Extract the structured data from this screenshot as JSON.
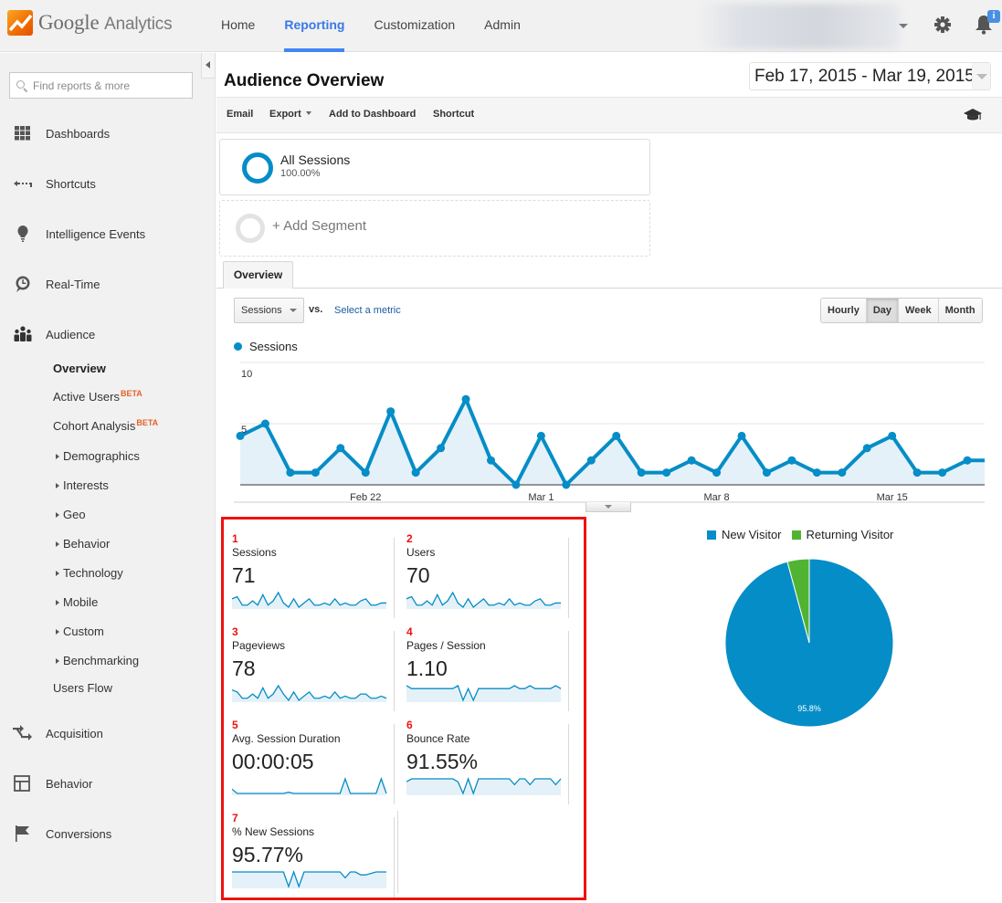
{
  "app": {
    "logo_google": "Google",
    "logo_product": "Analytics",
    "nav": [
      {
        "label": "Home",
        "active": false
      },
      {
        "label": "Reporting",
        "active": true
      },
      {
        "label": "Customization",
        "active": false
      },
      {
        "label": "Admin",
        "active": false
      }
    ],
    "notification_badge": "i"
  },
  "sidebar": {
    "search_placeholder": "Find reports & more",
    "sections": [
      {
        "label": "Dashboards",
        "icon": "grid-icon"
      },
      {
        "label": "Shortcuts",
        "icon": "shortcut-arrow-icon"
      },
      {
        "label": "Intelligence Events",
        "icon": "lightbulb-icon"
      },
      {
        "label": "Real-Time",
        "icon": "clock-bubble-icon"
      },
      {
        "label": "Audience",
        "icon": "people-icon"
      }
    ],
    "audience_items": [
      {
        "label": "Overview",
        "active": true,
        "expandable": false,
        "beta": ""
      },
      {
        "label": "Active Users",
        "active": false,
        "expandable": false,
        "beta": "BETA"
      },
      {
        "label": "Cohort Analysis",
        "active": false,
        "expandable": false,
        "beta": "BETA"
      },
      {
        "label": "Demographics",
        "active": false,
        "expandable": true,
        "beta": ""
      },
      {
        "label": "Interests",
        "active": false,
        "expandable": true,
        "beta": ""
      },
      {
        "label": "Geo",
        "active": false,
        "expandable": true,
        "beta": ""
      },
      {
        "label": "Behavior",
        "active": false,
        "expandable": true,
        "beta": ""
      },
      {
        "label": "Technology",
        "active": false,
        "expandable": true,
        "beta": ""
      },
      {
        "label": "Mobile",
        "active": false,
        "expandable": true,
        "beta": ""
      },
      {
        "label": "Custom",
        "active": false,
        "expandable": true,
        "beta": ""
      },
      {
        "label": "Benchmarking",
        "active": false,
        "expandable": true,
        "beta": ""
      },
      {
        "label": "Users Flow",
        "active": false,
        "expandable": false,
        "beta": ""
      }
    ],
    "bottom_sections": [
      {
        "label": "Acquisition",
        "icon": "acquisition-arrows-icon"
      },
      {
        "label": "Behavior",
        "icon": "layout-icon"
      },
      {
        "label": "Conversions",
        "icon": "flag-icon"
      }
    ]
  },
  "report": {
    "title": "Audience Overview",
    "date_range": "Feb 17, 2015 - Mar 19, 2015",
    "toolbar": {
      "email": "Email",
      "export": "Export",
      "add_to_dashboard": "Add to Dashboard",
      "shortcut": "Shortcut"
    },
    "segments": {
      "primary_name": "All Sessions",
      "primary_pct": "100.00%",
      "add_label": "+ Add Segment"
    },
    "tab": "Overview",
    "metric_selector": "Sessions",
    "vs_label": "vs.",
    "select_metric": "Select a metric",
    "granularity": [
      {
        "label": "Hourly",
        "active": false
      },
      {
        "label": "Day",
        "active": true
      },
      {
        "label": "Week",
        "active": false
      },
      {
        "label": "Month",
        "active": false
      }
    ]
  },
  "chart_data": [
    {
      "type": "area",
      "title": "",
      "legend": [
        "Sessions"
      ],
      "series_color": "#058dc7",
      "fill_color": "#e5f1f8",
      "x": [
        "Feb 17",
        "Feb 18",
        "Feb 19",
        "Feb 20",
        "Feb 21",
        "Feb 22",
        "Feb 23",
        "Feb 24",
        "Feb 25",
        "Feb 26",
        "Feb 27",
        "Feb 28",
        "Mar 1",
        "Mar 2",
        "Mar 3",
        "Mar 4",
        "Mar 5",
        "Mar 6",
        "Mar 7",
        "Mar 8",
        "Mar 9",
        "Mar 10",
        "Mar 11",
        "Mar 12",
        "Mar 13",
        "Mar 14",
        "Mar 15",
        "Mar 16",
        "Mar 17",
        "Mar 18",
        "Mar 19"
      ],
      "series": [
        {
          "name": "Sessions",
          "values": [
            4,
            5,
            1,
            1,
            3,
            1,
            6,
            1,
            3,
            7,
            2,
            0,
            4,
            0,
            2,
            4,
            1,
            1,
            2,
            1,
            4,
            1,
            2,
            1,
            1,
            3,
            4,
            1,
            1,
            2,
            2
          ]
        }
      ],
      "x_tick_labels": [
        "Feb 22",
        "Mar 1",
        "Mar 8",
        "Mar 15"
      ],
      "y_tick_labels": [
        "5",
        "10"
      ],
      "ylim": [
        0,
        10
      ],
      "grid": true
    },
    {
      "type": "pie",
      "title": "",
      "legend_position": "top",
      "slices": [
        {
          "label": "New Visitor",
          "value": 95.8,
          "color": "#058dc7"
        },
        {
          "label": "Returning Visitor",
          "value": 4.2,
          "color": "#50b432"
        }
      ],
      "data_labels": [
        "95.8%"
      ]
    }
  ],
  "scorecards": [
    {
      "index": "1",
      "name": "Sessions",
      "value": "71",
      "spark": [
        4,
        5,
        1,
        1,
        3,
        1,
        6,
        1,
        3,
        7,
        2,
        0,
        4,
        0,
        2,
        4,
        1,
        1,
        2,
        1,
        4,
        1,
        2,
        1,
        1,
        3,
        4,
        1,
        1,
        2,
        2
      ],
      "baseline": true
    },
    {
      "index": "2",
      "name": "Users",
      "value": "70",
      "spark": [
        4,
        5,
        1,
        1,
        3,
        1,
        6,
        1,
        3,
        7,
        2,
        0,
        4,
        0,
        2,
        4,
        1,
        1,
        2,
        1,
        4,
        1,
        2,
        1,
        1,
        3,
        4,
        1,
        1,
        2,
        2
      ],
      "baseline": true
    },
    {
      "index": "3",
      "name": "Pageviews",
      "value": "78",
      "spark": [
        5,
        4,
        1,
        1,
        3,
        1,
        6,
        1,
        3,
        7,
        3,
        0,
        4,
        0,
        2,
        4,
        1,
        1,
        2,
        1,
        4,
        1,
        2,
        1,
        1,
        3,
        3,
        1,
        1,
        2,
        1
      ],
      "baseline": true
    },
    {
      "index": "4",
      "name": "Pages / Session",
      "value": "1.10",
      "spark": [
        1,
        0.8,
        0.8,
        0.8,
        0.8,
        0.8,
        0.8,
        0.8,
        0.8,
        0.8,
        1,
        0,
        0.8,
        0,
        0.8,
        0.8,
        0.8,
        0.8,
        0.8,
        0.8,
        0.8,
        1,
        0.8,
        0.8,
        1,
        0.8,
        0.8,
        0.8,
        0.8,
        1,
        0.8
      ],
      "baseline": false
    },
    {
      "index": "5",
      "name": "Avg. Session Duration",
      "value": "00:00:05",
      "spark": [
        0.3,
        0,
        0,
        0,
        0,
        0,
        0,
        0,
        0,
        0,
        0,
        0.08,
        0,
        0,
        0,
        0,
        0,
        0,
        0,
        0,
        0,
        0,
        1,
        0,
        0,
        0,
        0,
        0,
        0,
        1,
        0
      ],
      "baseline": true
    },
    {
      "index": "6",
      "name": "Bounce Rate",
      "value": "91.55%",
      "spark": [
        0.8,
        1,
        1,
        1,
        1,
        1,
        1,
        1,
        1,
        1,
        0.8,
        0,
        1,
        0,
        1,
        1,
        1,
        1,
        1,
        1,
        1,
        0.6,
        1,
        1,
        0.6,
        1,
        1,
        1,
        1,
        0.6,
        1
      ],
      "baseline": false
    },
    {
      "index": "7",
      "name": "% New Sessions",
      "value": "95.77%",
      "spark": [
        1,
        1,
        1,
        1,
        1,
        1,
        1,
        1,
        1,
        1,
        1,
        0,
        1,
        0,
        1,
        1,
        1,
        1,
        1,
        1,
        1,
        1,
        0.6,
        1,
        1,
        0.8,
        0.8,
        0.9,
        1,
        1,
        1
      ],
      "baseline": false
    }
  ]
}
